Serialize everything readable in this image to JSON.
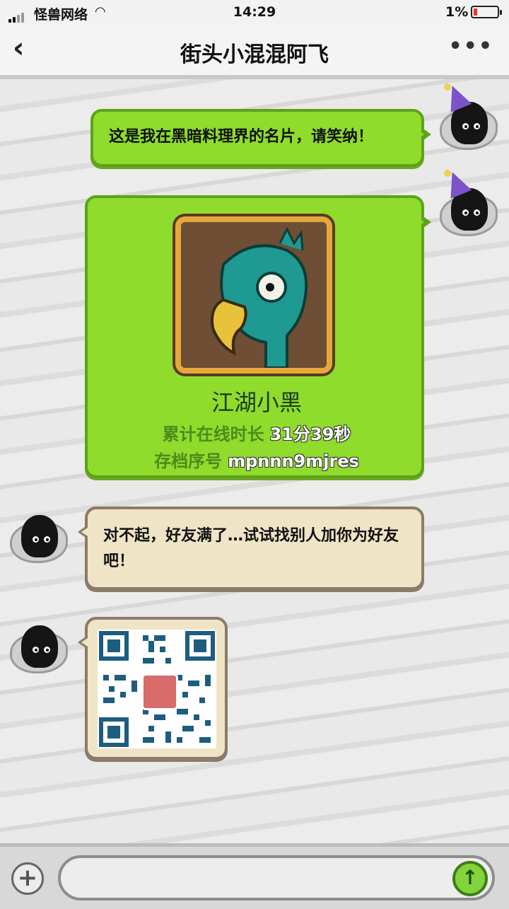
{
  "status_bar": {
    "carrier": "怪兽网络",
    "time": "14:29",
    "battery_percent": "1%"
  },
  "header": {
    "back_icon": "chevron-left-icon",
    "title": "街头小混混阿飞",
    "more_icon": "more-dots-icon"
  },
  "messages": [
    {
      "side": "right",
      "text": "这是我在黑暗料理界的名片，请笑纳！"
    },
    {
      "side": "right",
      "type": "card",
      "card": {
        "name": "江湖小黑",
        "online_label": "累计在线时长",
        "online_value": "31分39秒",
        "save_label": "存档序号",
        "save_value": "mpnnn9mjres"
      }
    },
    {
      "side": "left",
      "text": "对不起，好友满了…试试找别人加你为好友吧！"
    },
    {
      "side": "left",
      "type": "qr_code"
    }
  ],
  "composer": {
    "plus_icon": "plus-icon",
    "send_icon": "send-arrow-up-icon",
    "input_value": ""
  },
  "colors": {
    "bubble_green": "#8fdc2c",
    "bubble_beige": "#efe4c6",
    "send_button": "#83d43a"
  }
}
